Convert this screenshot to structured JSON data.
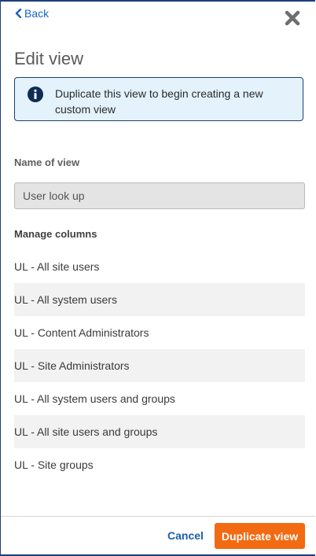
{
  "header": {
    "back_label": "Back",
    "title": "Edit view"
  },
  "info": {
    "message": "Duplicate this view to begin creating a new custom view"
  },
  "name_field": {
    "label": "Name of view",
    "value": "User look up"
  },
  "columns": {
    "label": "Manage columns",
    "items": [
      "UL - All site users",
      "UL - All system users",
      "UL - Content Administrators",
      "UL - Site Administrators",
      "UL - All system users and groups",
      "UL - All site users and groups",
      "UL - Site groups"
    ]
  },
  "footer": {
    "cancel_label": "Cancel",
    "duplicate_label": "Duplicate view"
  },
  "colors": {
    "accent_orange": "#f26a12",
    "link_blue": "#1565c0",
    "info_bg": "#e3f2fb",
    "info_icon": "#0f2d52"
  }
}
